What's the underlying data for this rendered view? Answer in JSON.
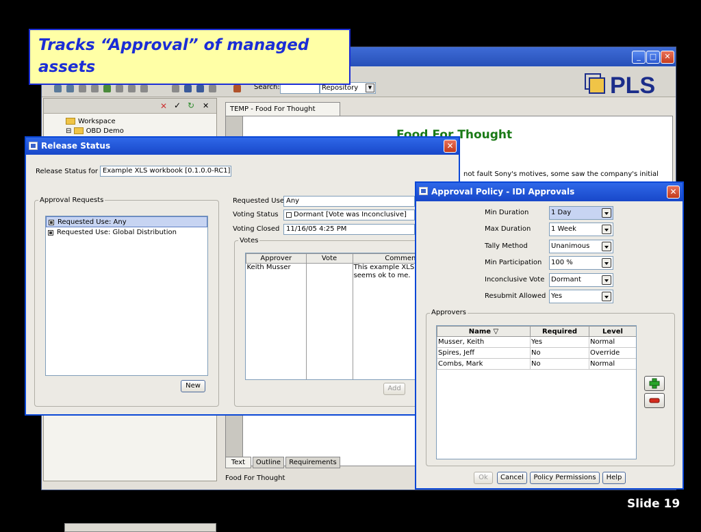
{
  "callout": {
    "text": "Tracks “Approval” of managed assets"
  },
  "slide_label": "Slide 19",
  "bg_app": {
    "search_label": "Search:",
    "repository": "Repository",
    "logo": "PLS",
    "tree": {
      "workspace": "Workspace",
      "obd_demo": "OBD Demo"
    },
    "doc_tab": "TEMP - Food For Thought",
    "doc_title": "Food For Thought",
    "doc_text": "not fault Sony's motives, some saw the company's initial",
    "bottom_tabs": [
      "Text",
      "Outline",
      "Requirements"
    ],
    "status": "Food For Thought"
  },
  "release": {
    "title": "Release Status",
    "for_label": "Release Status for",
    "for_value": "Example XLS workbook [0.1.0.0-RC1]",
    "approval_requests_label": "Approval Requests",
    "requests": [
      "Requested Use: Any",
      "Requested Use: Global Distribution"
    ],
    "new_button": "New",
    "requested_use_label": "Requested Use",
    "requested_use_value": "Any",
    "voting_status_label": "Voting Status",
    "voting_status_value": "Dormant [Vote was Inconclusive]",
    "voting_closed_label": "Voting Closed",
    "voting_closed_value": "11/16/05 4:25 PM",
    "votes_label": "Votes",
    "votes_columns": [
      "Approver",
      "Vote",
      "Comment"
    ],
    "votes_rows": [
      {
        "approver": "Keith Musser",
        "vote": "",
        "comment": "This example XLS spread seems ok to me."
      }
    ],
    "add_button": "Add"
  },
  "policy": {
    "title": "Approval Policy - IDI Approvals",
    "fields": [
      {
        "label": "Min Duration",
        "value": "1 Day"
      },
      {
        "label": "Max Duration",
        "value": "1 Week"
      },
      {
        "label": "Tally Method",
        "value": "Unanimous"
      },
      {
        "label": "Min Participation",
        "value": "100 %"
      },
      {
        "label": "Inconclusive Vote",
        "value": "Dormant"
      },
      {
        "label": "Resubmit Allowed",
        "value": "Yes"
      }
    ],
    "approvers_label": "Approvers",
    "columns": [
      "Name ▽",
      "Required",
      "Level"
    ],
    "rows": [
      {
        "name": "Musser, Keith",
        "required": "Yes",
        "level": "Normal"
      },
      {
        "name": "Spires, Jeff",
        "required": "No",
        "level": "Override"
      },
      {
        "name": "Combs, Mark",
        "required": "No",
        "level": "Normal"
      }
    ],
    "buttons": {
      "ok": "Ok",
      "cancel": "Cancel",
      "permissions": "Policy Permissions",
      "help": "Help"
    }
  }
}
